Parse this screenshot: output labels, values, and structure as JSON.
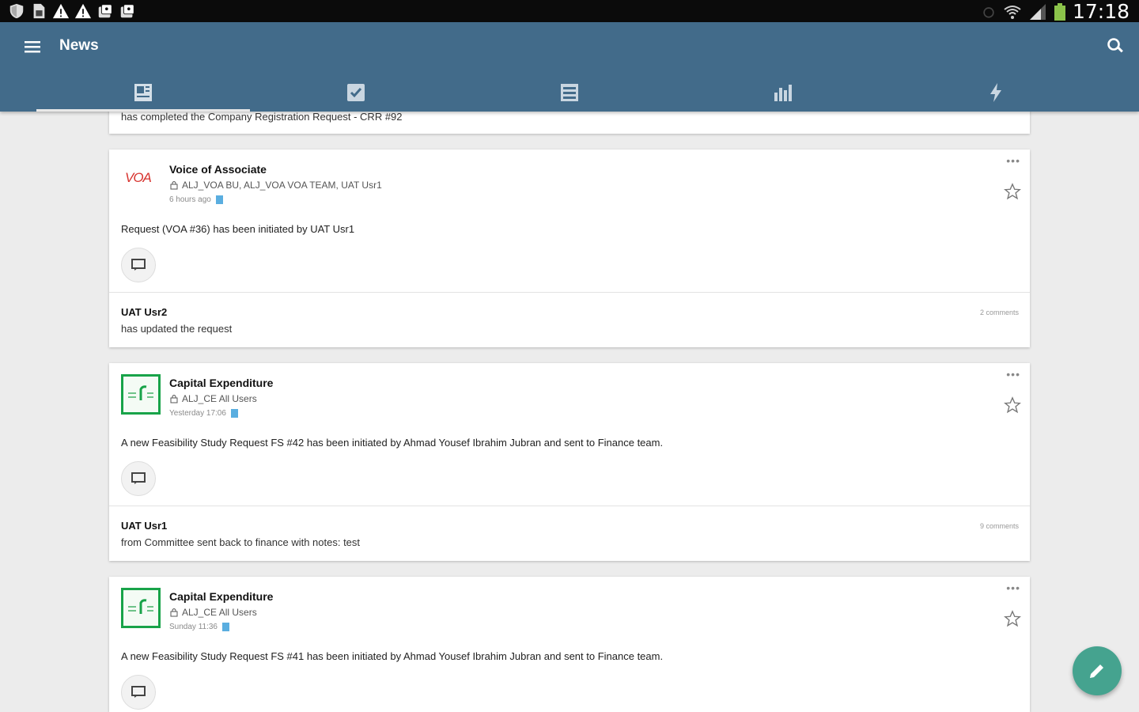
{
  "status_bar": {
    "time": "17:18",
    "left_icons": [
      "shield-icon",
      "sim-icon",
      "warning-icon",
      "warning-icon",
      "gallery-icon",
      "gallery-icon"
    ],
    "right_icons": [
      "alarm-icon",
      "wifi-icon",
      "signal-icon",
      "battery-icon"
    ]
  },
  "app_bar": {
    "title": "News",
    "color": "#426b8a",
    "tabs": [
      {
        "icon": "news-icon",
        "active": true
      },
      {
        "icon": "task-check-icon",
        "active": false
      },
      {
        "icon": "list-icon",
        "active": false
      },
      {
        "icon": "bar-chart-icon",
        "active": false
      },
      {
        "icon": "lightning-icon",
        "active": false
      }
    ]
  },
  "feed": {
    "partial_top": {
      "text": "has completed the Company Registration Request - CRR #92"
    },
    "posts": [
      {
        "logo": "VOA",
        "title": "Voice of Associate",
        "audience": "ALJ_VOA BU, ALJ_VOA VOA TEAM, UAT Usr1",
        "time": "6 hours ago",
        "body": "Request (VOA #36) has been initiated by UAT Usr1",
        "activity_user": "UAT Usr2",
        "activity_text": "has updated the request",
        "comments": "2 comments"
      },
      {
        "logo": "capex-logo",
        "title": "Capital Expenditure",
        "audience": "ALJ_CE All Users",
        "time": "Yesterday 17:06",
        "body": "A new Feasibility Study Request FS #42 has been initiated by Ahmad Yousef Ibrahim Jubran and sent to Finance team.",
        "activity_user": "UAT Usr1",
        "activity_text": "from Committee sent back to finance with notes: test",
        "comments": "9 comments"
      },
      {
        "logo": "capex-logo",
        "title": "Capital Expenditure",
        "audience": "ALJ_CE All Users",
        "time": "Sunday 11:36",
        "body": "A new Feasibility Study Request FS #41 has been initiated by Ahmad Yousef Ibrahim Jubran and sent to Finance team."
      }
    ]
  },
  "more_label": "•••",
  "fab": {
    "icon": "pencil-icon",
    "color": "#45a38f"
  }
}
